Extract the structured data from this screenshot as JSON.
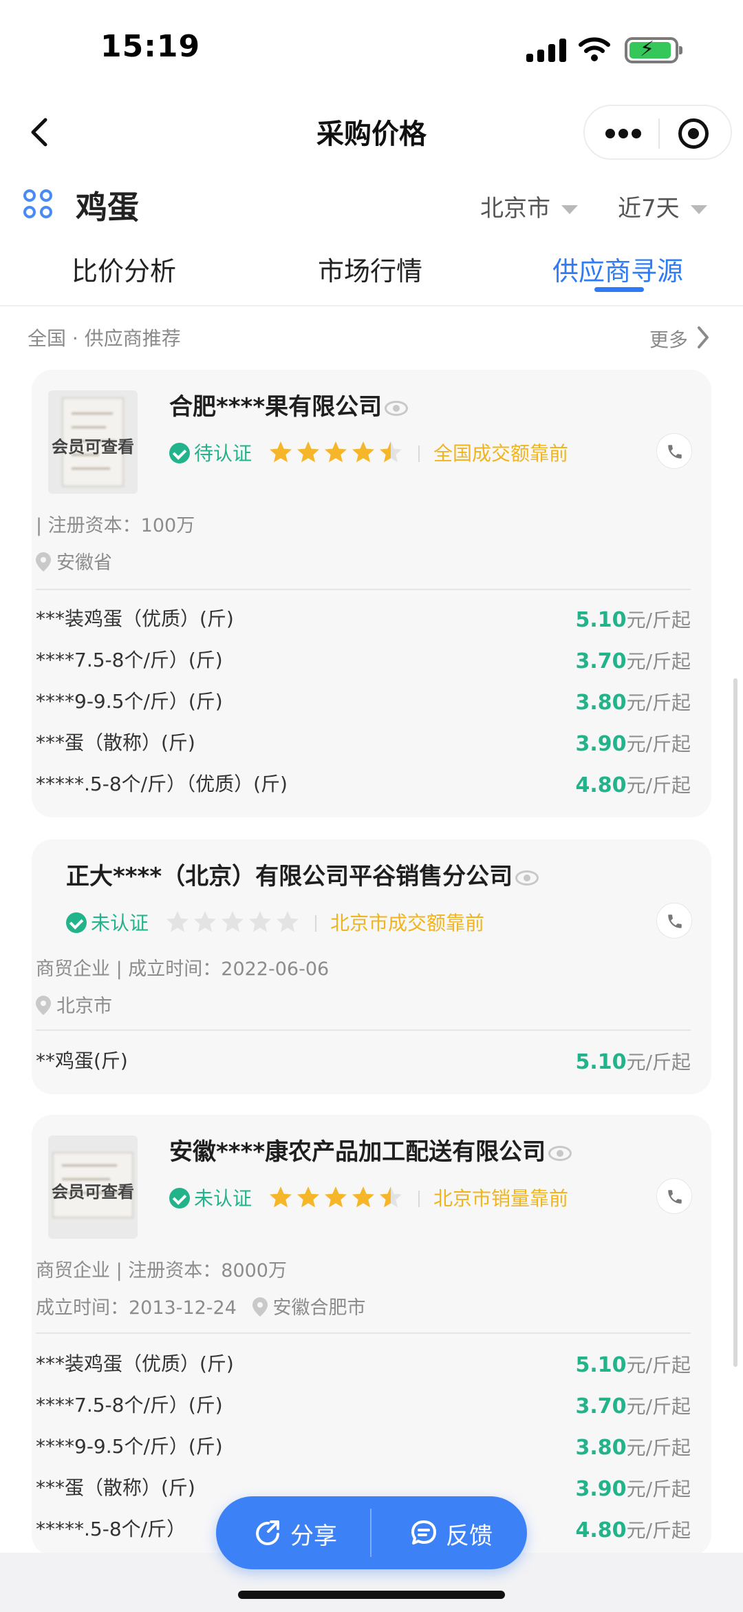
{
  "status_bar": {
    "time": "15:19"
  },
  "nav": {
    "title": "采购价格"
  },
  "product": {
    "name": "鸡蛋",
    "region_filter": "北京市",
    "period_filter": "近7天"
  },
  "tabs": [
    {
      "label": "比价分析"
    },
    {
      "label": "市场行情"
    },
    {
      "label": "供应商寻源"
    }
  ],
  "active_tab": "供应商寻源",
  "section": {
    "title": "全国 · 供应商推荐",
    "more": "更多"
  },
  "suppliers": [
    {
      "name": "合肥****果有限公司",
      "thumb_label": "会员可查看",
      "cert": "待认证",
      "rating": 4.5,
      "rank": "全国成交额靠前",
      "meta1": "| 注册资本：100万",
      "location": "安徽省",
      "items": [
        {
          "name": "***装鸡蛋（优质）(斤)",
          "price": "5.10",
          "unit": "元/斤起"
        },
        {
          "name": "****7.5-8个/斤）(斤)",
          "price": "3.70",
          "unit": "元/斤起"
        },
        {
          "name": "****9-9.5个/斤）(斤)",
          "price": "3.80",
          "unit": "元/斤起"
        },
        {
          "name": "***蛋（散称）(斤)",
          "price": "3.90",
          "unit": "元/斤起"
        },
        {
          "name": "*****.5-8个/斤）（优质）(斤)",
          "price": "4.80",
          "unit": "元/斤起"
        }
      ]
    },
    {
      "name": "正大****（北京）有限公司平谷销售分公司",
      "cert": "未认证",
      "rating": 0,
      "rank": "北京市成交额靠前",
      "meta1": "商贸企业 | 成立时间：2022-06-06",
      "location": "北京市",
      "items": [
        {
          "name": "**鸡蛋(斤)",
          "price": "5.10",
          "unit": "元/斤起"
        }
      ]
    },
    {
      "name": "安徽****康农产品加工配送有限公司",
      "thumb_label": "会员可查看",
      "cert": "未认证",
      "rating": 4.5,
      "rank": "北京市销量靠前",
      "meta1": "商贸企业 | 注册资本：8000万",
      "meta2": "成立时间：2013-12-24",
      "location": "安徽合肥市",
      "items": [
        {
          "name": "***装鸡蛋（优质）(斤)",
          "price": "5.10",
          "unit": "元/斤起"
        },
        {
          "name": "****7.5-8个/斤）(斤)",
          "price": "3.70",
          "unit": "元/斤起"
        },
        {
          "name": "****9-9.5个/斤）(斤)",
          "price": "3.80",
          "unit": "元/斤起"
        },
        {
          "name": "***蛋（散称）(斤)",
          "price": "3.90",
          "unit": "元/斤起"
        },
        {
          "name": "*****.5-8个/斤）",
          "price": "4.80",
          "unit": "元/斤起"
        }
      ]
    }
  ],
  "actions": {
    "share": "分享",
    "feedback": "反馈"
  },
  "colors": {
    "accent": "#3c82f6",
    "price": "#22b38a",
    "rank": "#f0b41e",
    "star": "#f6b62a"
  }
}
